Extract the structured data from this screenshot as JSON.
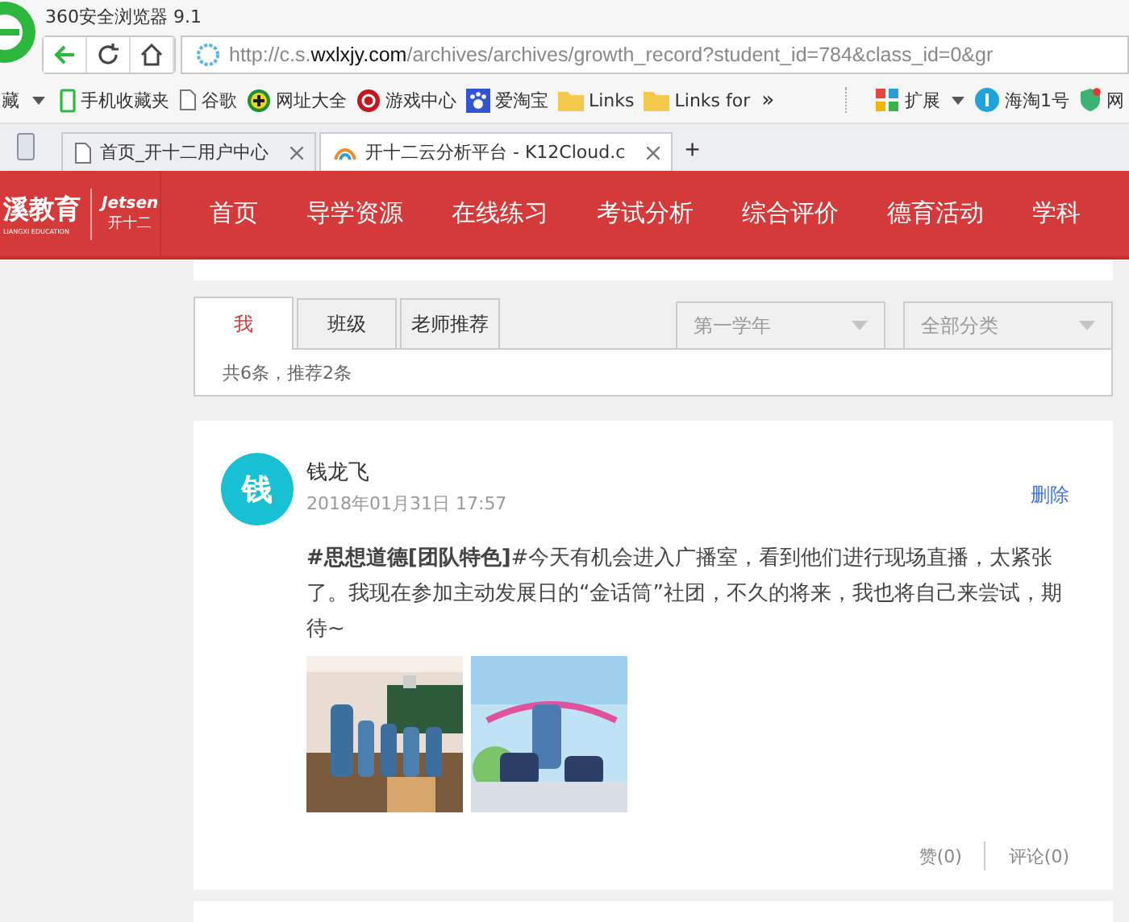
{
  "browser": {
    "title": "360安全浏览器 9.1",
    "url": {
      "prefix": "http://c.s.",
      "domain": "wxlxjy.com",
      "path": "/archives/archives/growth_record?student_id=784&class_id=0&gr"
    }
  },
  "bookmarks": {
    "cut_label": "藏",
    "items": [
      {
        "label": "手机收藏夹",
        "kind": "phone"
      },
      {
        "label": "谷歌",
        "kind": "page"
      },
      {
        "label": "网址大全",
        "kind": "plus"
      },
      {
        "label": "游戏中心",
        "kind": "game"
      },
      {
        "label": "爱淘宝",
        "kind": "paw"
      },
      {
        "label": "Links",
        "kind": "folder"
      },
      {
        "label": "Links for",
        "kind": "folder"
      }
    ],
    "more": "»",
    "right": [
      {
        "label": "扩展",
        "kind": "grid"
      },
      {
        "label": "海淘1号",
        "kind": "ring"
      },
      {
        "label": "网",
        "kind": "shield"
      }
    ]
  },
  "tabs": [
    {
      "label": "首页_开十二用户中心",
      "selected": false
    },
    {
      "label": "开十二云分析平台 - K12Cloud.c",
      "selected": true
    }
  ],
  "new_tab": "+",
  "site": {
    "logo": "溪教育",
    "logo_sub": "LIANGXI EDUCATION",
    "brand": "Jetsen",
    "brand_sub": "开十二",
    "nav": [
      "首页",
      "导学资源",
      "在线练习",
      "考试分析",
      "综合评价",
      "德育活动",
      "学科"
    ]
  },
  "filter": {
    "tabs": [
      {
        "label": "我",
        "selected": true
      },
      {
        "label": "班级",
        "selected": false
      },
      {
        "label": "老师推荐",
        "selected": false
      }
    ],
    "selects": [
      {
        "value": "第一学年"
      },
      {
        "value": "全部分类"
      }
    ],
    "summary": "共6条，推荐2条"
  },
  "post": {
    "avatar": "钱",
    "author": "钱龙飞",
    "date": "2018年01月31日 17:57",
    "delete": "删除",
    "text": "**#思想道德[团队特色]**#今天有机会进入广播室，看到他们进行现场直播，太紧张了。我现在参加主动发展日的“金话筒”社团，不久的将来，我也将自己来尝试，期待~",
    "like": "赞(0)",
    "comment": "评论(0)"
  }
}
